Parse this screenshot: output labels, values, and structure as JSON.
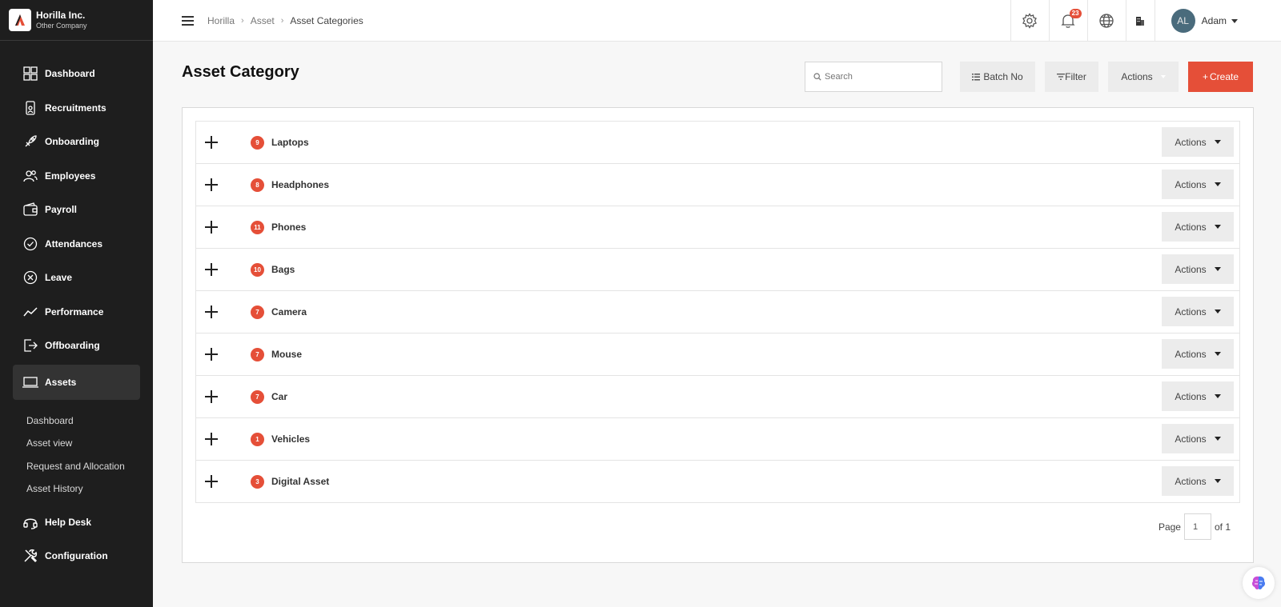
{
  "brand": {
    "company": "Horilla Inc.",
    "subtitle": "Other Company"
  },
  "sidebar": {
    "items": [
      {
        "label": "Dashboard",
        "icon": "dashboard-icon"
      },
      {
        "label": "Recruitments",
        "icon": "recruitment-icon"
      },
      {
        "label": "Onboarding",
        "icon": "rocket-icon"
      },
      {
        "label": "Employees",
        "icon": "people-icon"
      },
      {
        "label": "Payroll",
        "icon": "wallet-icon"
      },
      {
        "label": "Attendances",
        "icon": "check-circle-icon"
      },
      {
        "label": "Leave",
        "icon": "x-circle-icon"
      },
      {
        "label": "Performance",
        "icon": "trend-icon"
      },
      {
        "label": "Offboarding",
        "icon": "exit-icon"
      },
      {
        "label": "Assets",
        "icon": "laptop-icon"
      }
    ],
    "submenu": [
      "Dashboard",
      "Asset view",
      "Request and Allocation",
      "Asset History"
    ],
    "bottom_items": [
      {
        "label": "Help Desk",
        "icon": "headset-icon"
      },
      {
        "label": "Configuration",
        "icon": "tools-icon"
      }
    ]
  },
  "header": {
    "breadcrumb": [
      "Horilla",
      "Asset",
      "Asset Categories"
    ],
    "notification_count": "23",
    "user": {
      "initials": "AL",
      "name": "Adam"
    }
  },
  "page": {
    "title": "Asset Category",
    "search_placeholder": "Search",
    "batch_label": "Batch No",
    "filter_label": "Filter",
    "actions_label": "Actions",
    "create_label": "Create"
  },
  "categories": [
    {
      "count": "9",
      "name": "Laptops"
    },
    {
      "count": "8",
      "name": "Headphones"
    },
    {
      "count": "11",
      "name": "Phones"
    },
    {
      "count": "10",
      "name": "Bags"
    },
    {
      "count": "7",
      "name": "Camera"
    },
    {
      "count": "7",
      "name": "Mouse"
    },
    {
      "count": "7",
      "name": "Car"
    },
    {
      "count": "1",
      "name": "Vehicles"
    },
    {
      "count": "3",
      "name": "Digital Asset"
    }
  ],
  "row_actions_label": "Actions",
  "pager": {
    "prefix": "Page",
    "current": "1",
    "suffix": "of 1"
  },
  "colors": {
    "accent": "#e54f38",
    "sidebar": "#1e1e1e"
  }
}
